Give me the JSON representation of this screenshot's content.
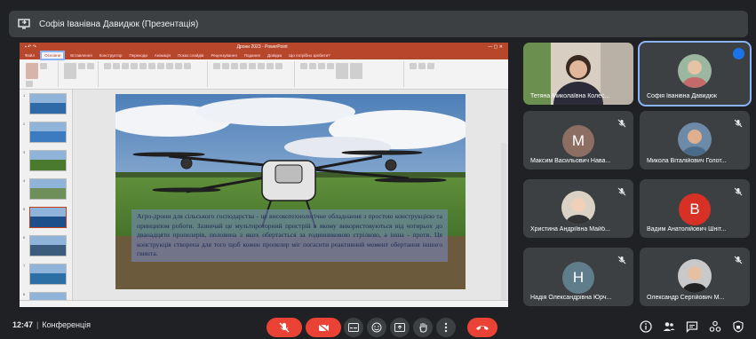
{
  "topbar": {
    "title": "Софія Іванівна Давидюк (Презентація)",
    "icon": "presentation-icon"
  },
  "powerpoint": {
    "window_title": "Дрони 2023 - PowerPoint",
    "tabs": [
      "Файл",
      "Основне",
      "Вставлення",
      "Конструктор",
      "Переходи",
      "Анімація",
      "Показ слайдів",
      "Рецензування",
      "Подання",
      "Довідка",
      "Що потрібно зробити?"
    ],
    "active_tab": "Основне",
    "slide_count_visible": 8,
    "selected_slide": 5,
    "slide_caption": "Агро-дрони для сільського господарства - це високотехнологічне обладнання з простою конструкцією та принципом роботи. Зазвичай це мультироторний пристрій в якому використовуються від чотирьох до дванадцяти пропелерів, половина з яких обертається за годинниковою стрілкою, а інша - проти. Ця конструкція створена для того щоб кожен пропелер міг погасити реактивний момент обертання іншого гвинта."
  },
  "participants": [
    {
      "name": "Тетяна Миколаївна Колес...",
      "type": "video",
      "muted": false
    },
    {
      "name": "Софія Іванівна Давидюк",
      "type": "video",
      "active_speaker": true,
      "muted": false
    },
    {
      "name": "Максим Васильович Нава...",
      "type": "letter",
      "initial": "М",
      "color": "#8d6e63",
      "muted": true
    },
    {
      "name": "Микола Віталійович Голот...",
      "type": "photo",
      "muted": true
    },
    {
      "name": "Христина Андріївна Майб...",
      "type": "photo",
      "muted": true
    },
    {
      "name": "Вадим Анатолійович Шніт...",
      "type": "letter",
      "initial": "В",
      "color": "#d93025",
      "muted": true
    },
    {
      "name": "Надія Олександрівна Юрч...",
      "type": "letter",
      "initial": "Н",
      "color": "#607d8b",
      "muted": true
    },
    {
      "name": "Олександр Сергійович М...",
      "type": "photo",
      "muted": true
    }
  ],
  "bottombar": {
    "time": "12:47",
    "meeting_name": "Конференція",
    "controls": [
      "mic-off-icon",
      "camera-off-icon",
      "captions-icon",
      "emoji-icon",
      "present-icon",
      "raise-hand-icon",
      "more-icon",
      "leave-call-icon"
    ],
    "right_controls": [
      "info-icon",
      "people-icon",
      "chat-icon",
      "activities-icon",
      "host-controls-icon"
    ]
  }
}
